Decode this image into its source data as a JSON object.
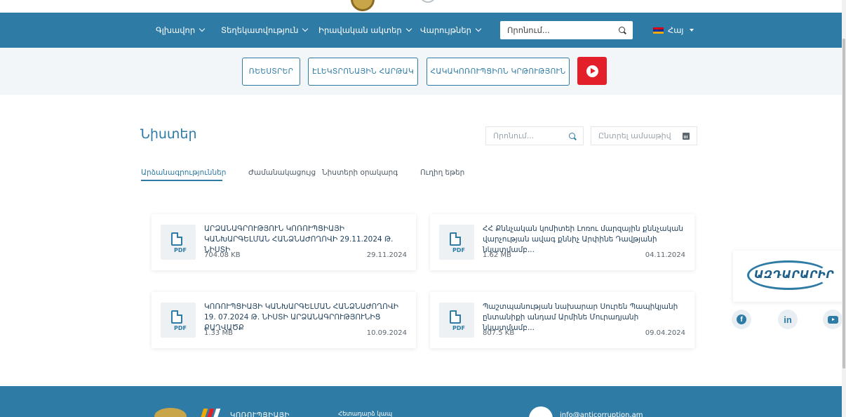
{
  "header": {
    "nav": [
      {
        "label": "Գլխավոր"
      },
      {
        "label": "Տեղեկատվություն"
      },
      {
        "label": "Իրավական ակտեր"
      },
      {
        "label": "Վարույթներ"
      }
    ],
    "search_placeholder": "Որոնում...",
    "language": "Հայ"
  },
  "quick_links": {
    "registers": "ՌԵԵՍՏՐԵՐ",
    "e_platform": "ԷԼԵԿՏՐՈՆԱՅԻՆ ՀԱՐԹԱԿ",
    "anticorruption": "ՀԱԿԱԿՈՌՈՒՊՑԻՈՆ ԿՐԹՈՒԹՅՈՒՆ",
    "video_icon": "play-icon"
  },
  "page": {
    "title": "Նիստեր",
    "search_placeholder": "Որոնում...",
    "date_placeholder": "Ընտրել ամսաթիվ"
  },
  "tabs": [
    {
      "label": "Արձանագրություններ",
      "active": true
    },
    {
      "label": "Ժամանակացույց",
      "active": false
    },
    {
      "label": "Նիստերի օրակարգ",
      "active": false
    },
    {
      "label": "Ուղիղ եթեր",
      "active": false
    }
  ],
  "documents": [
    {
      "title": "ԱՐՁԱՆԱԳՐՈՒԹՅՈՒՆ ԿՈՌՈՒՊՑԻԱՅԻ ԿԱՆԽԱՐԳԵԼՄԱՆ ՀԱՆՁՆԱԺՈՂՈՎԻ 29.11.2024 Թ. ՆԻՍՏԻ",
      "size": "704.08 KB",
      "date": "29.11.2024",
      "badge": "PDF"
    },
    {
      "title": "ՀՀ Քննչական կոմիտեի Լոռու մարզային քննչական վարչության ավագ քննիչ Արփինե Դավթյանի նկատմամբ...",
      "size": "1.62 MB",
      "date": "04.11.2024",
      "badge": "PDF"
    },
    {
      "title": "ԿՈՌՈՒՊՑԻԱՅԻ ԿԱՆԽԱՐԳԵԼՄԱՆ ՀԱՆՁՆԱԺՈՂՈՎԻ 19. 07.2024 Թ. ՆԻՍՏԻ ԱՐՁԱՆԱԳՐՈՒԹՅՈՒՆԻՑ ՔԱՂՎԱԾՔ",
      "size": "1.33 MB",
      "date": "10.09.2024",
      "badge": "PDF"
    },
    {
      "title": "Պաշտպանության նախարար Սուրեն Պապիկյանի ընտանիքի անդամ Արմինե Մուրադյանի նկատմամբ...",
      "size": "807.5 KB",
      "date": "09.04.2024",
      "badge": "PDF"
    }
  ],
  "footer": {
    "org_fragment": "ԿՈՌՈՒՊՑԻԱՅԻ",
    "contact_label": "Հետադարձ կապ",
    "email_fragment": "info@anticorruption.am"
  },
  "side": {
    "logo_text": "ԱԶԴԱՐԱՐԻՐ",
    "social": [
      "facebook-icon",
      "linkedin-icon",
      "youtube-icon"
    ]
  },
  "colors": {
    "primary": "#2e7ba5",
    "accent_red": "#e3202a",
    "band": "#f3f6f8"
  }
}
